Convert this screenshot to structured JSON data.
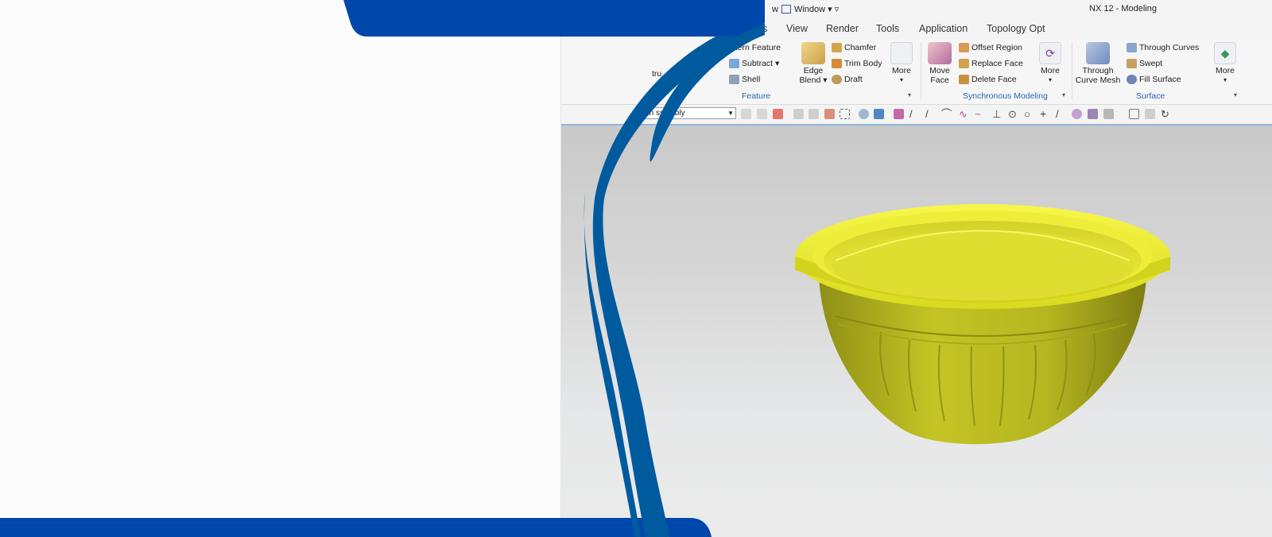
{
  "window": {
    "title": "NX 12 - Modeling",
    "quick_access": {
      "prefix": "w",
      "window_menu": "Window ▾ ▿"
    }
  },
  "menu": [
    "s",
    "View",
    "Render",
    "Tools",
    "Application",
    "Topology Opt"
  ],
  "ribbon": {
    "feature": {
      "extrude_fragment": "tru",
      "pattern_feature": "attern Feature",
      "subtract": "Subtract ▾",
      "shell": "Shell",
      "edge_blend": [
        "Edge",
        "Blend ▾"
      ],
      "chamfer": "Chamfer",
      "trim_body": "Trim Body",
      "draft": "Draft",
      "more": "More",
      "group_label": "Feature"
    },
    "synchronous": {
      "move_face": [
        "Move",
        "Face"
      ],
      "offset_region": "Offset Region",
      "replace_face": "Replace Face",
      "delete_face": "Delete Face",
      "more": "More",
      "group_label": "Synchronous Modeling"
    },
    "surface": {
      "through_curve_mesh": [
        "Through",
        "Curve Mesh"
      ],
      "through_curves": "Through Curves",
      "swept": "Swept",
      "fill_surface": "Fill Surface",
      "more": "More",
      "group_label": "Surface"
    }
  },
  "selection_bar": {
    "filter_value": "En   ssembly"
  },
  "colors": {
    "brand_blue": "#0047AB",
    "swoosh_blue": "#005a9e",
    "model_yellow": "#e6e61e",
    "group_label": "#2b64b0"
  }
}
